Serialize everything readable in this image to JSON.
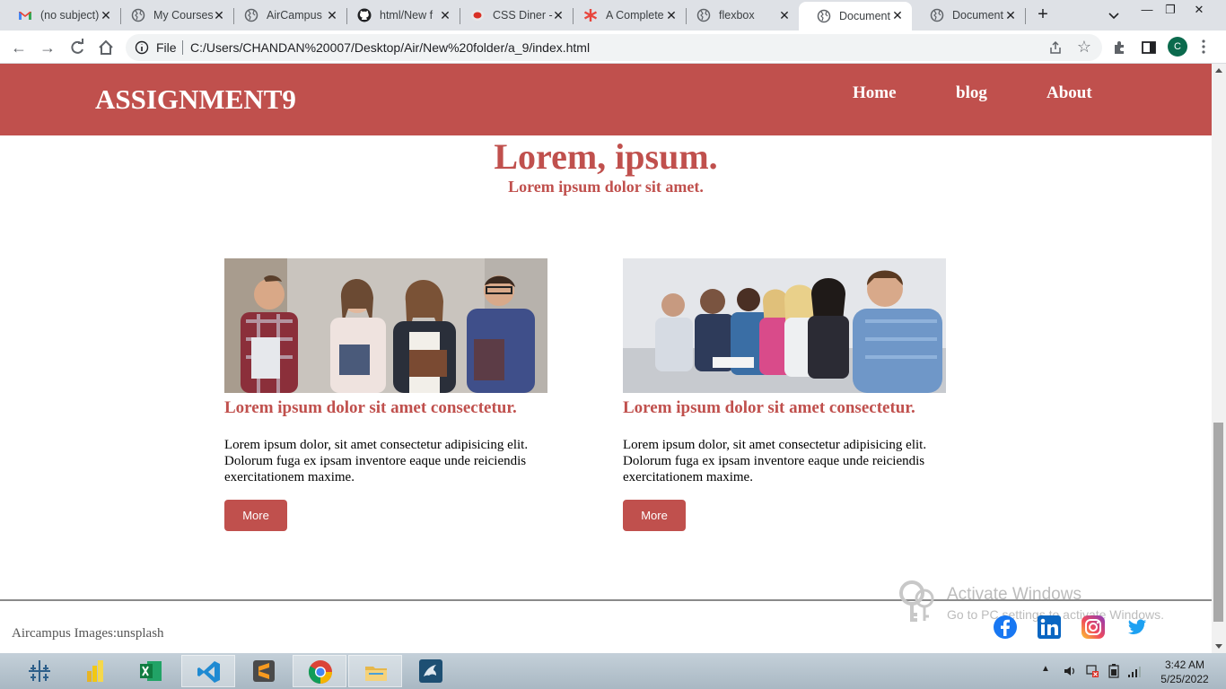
{
  "browser": {
    "tabs": [
      {
        "title": "(no subject)",
        "icon": "gmail-icon"
      },
      {
        "title": "My Courses",
        "icon": "globe-icon"
      },
      {
        "title": "AirCampus",
        "icon": "globe-icon"
      },
      {
        "title": "html/New f",
        "icon": "github-icon"
      },
      {
        "title": "CSS Diner -",
        "icon": "css-diner-icon"
      },
      {
        "title": "A Complete",
        "icon": "asterisk-icon"
      },
      {
        "title": "flexbox",
        "icon": "globe-icon"
      },
      {
        "title": "Document",
        "icon": "globe-icon"
      },
      {
        "title": "Document",
        "icon": "globe-icon"
      }
    ],
    "active_tab": 7,
    "file_label": "File",
    "url": "C:/Users/CHANDAN%20007/Desktop/Air/New%20folder/a_9/index.html",
    "profile_initial": "C"
  },
  "site": {
    "logo": "ASSIGNMENT9",
    "nav": [
      "Home",
      "blog",
      "About"
    ],
    "hero_title": "Lorem, ipsum.",
    "hero_subtitle": "Lorem ipsum dolor sit amet.",
    "cards": [
      {
        "heading": "Lorem ipsum dolor sit amet consectetur.",
        "body": "Lorem ipsum dolor, sit amet consectetur adipisicing elit. Dolorum fuga ex ipsam inventore eaque unde reiciendis exercitationem maxime.",
        "button": "More"
      },
      {
        "heading": "Lorem ipsum dolor sit amet consectetur.",
        "body": "Lorem ipsum dolor, sit amet consectetur adipisicing elit. Dolorum fuga ex ipsam inventore eaque unde reiciendis exercitationem maxime.",
        "button": "More"
      }
    ],
    "footer_text": "Aircampus Images:unsplash",
    "social": [
      "facebook-icon",
      "linkedin-icon",
      "instagram-icon",
      "twitter-icon"
    ],
    "accent_color": "#c0504d"
  },
  "watermark": {
    "line1": "Activate Windows",
    "line2": "Go to PC settings to activate Windows."
  },
  "taskbar": {
    "apps": [
      "tableau-icon",
      "power-bi-icon",
      "excel-icon",
      "vscode-icon",
      "sublime-text-icon",
      "chrome-icon",
      "file-explorer-icon",
      "mysql-workbench-icon"
    ],
    "time": "3:42 AM",
    "date": "5/25/2022"
  }
}
